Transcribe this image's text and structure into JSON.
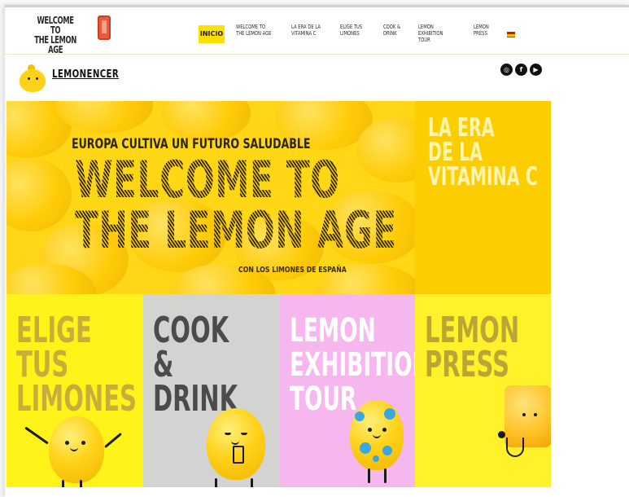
{
  "header": {
    "brand_line1": "WELCOME TO",
    "brand_line2": "THE LEMON AGE",
    "home_label": "INICIO",
    "nav": [
      {
        "line1": "WELCOME TO",
        "line2": "THE LEMON AGE"
      },
      {
        "line1": "LA ERA DE LA",
        "line2": "VITAMINA C"
      },
      {
        "line1": "ELIGE TUS",
        "line2": "LIMONES"
      },
      {
        "line1": "COOK &",
        "line2": "DRINK"
      },
      {
        "line1": "LEMON",
        "line2": "EXHIBITION TOUR"
      },
      {
        "line1": "LEMON",
        "line2": "PRESS"
      }
    ],
    "language_flag": "spain-flag-icon"
  },
  "subbar": {
    "lemonencer": "LEMONENCER",
    "social_icons": [
      "instagram-icon",
      "facebook-icon",
      "youtube-icon"
    ]
  },
  "hero": {
    "kicker": "EUROPA CULTIVA UN FUTURO SALUDABLE",
    "title_line1": "WELCOME TO",
    "title_line2": "THE LEMON AGE",
    "subtitle": "CON LOS LIMONES DE ESPAÑA"
  },
  "vitamin_tile": {
    "line1": "LA ERA",
    "line2": "DE LA",
    "line3": "VITAMINA C"
  },
  "tiles": [
    {
      "lines": [
        "ELIGE",
        "TUS",
        "LIMONES"
      ]
    },
    {
      "lines": [
        "COOK",
        "&",
        "DRINK"
      ]
    },
    {
      "lines": [
        "LEMON",
        "EXHIBITION",
        "TOUR"
      ]
    },
    {
      "lines": [
        "LEMON",
        "PRESS"
      ]
    }
  ],
  "colors": {
    "brand_yellow": "#ffe000",
    "hero_yellow": "#ffd71a",
    "tile_pink": "#f6b6ee",
    "tile_grey": "#d3d3d1"
  }
}
